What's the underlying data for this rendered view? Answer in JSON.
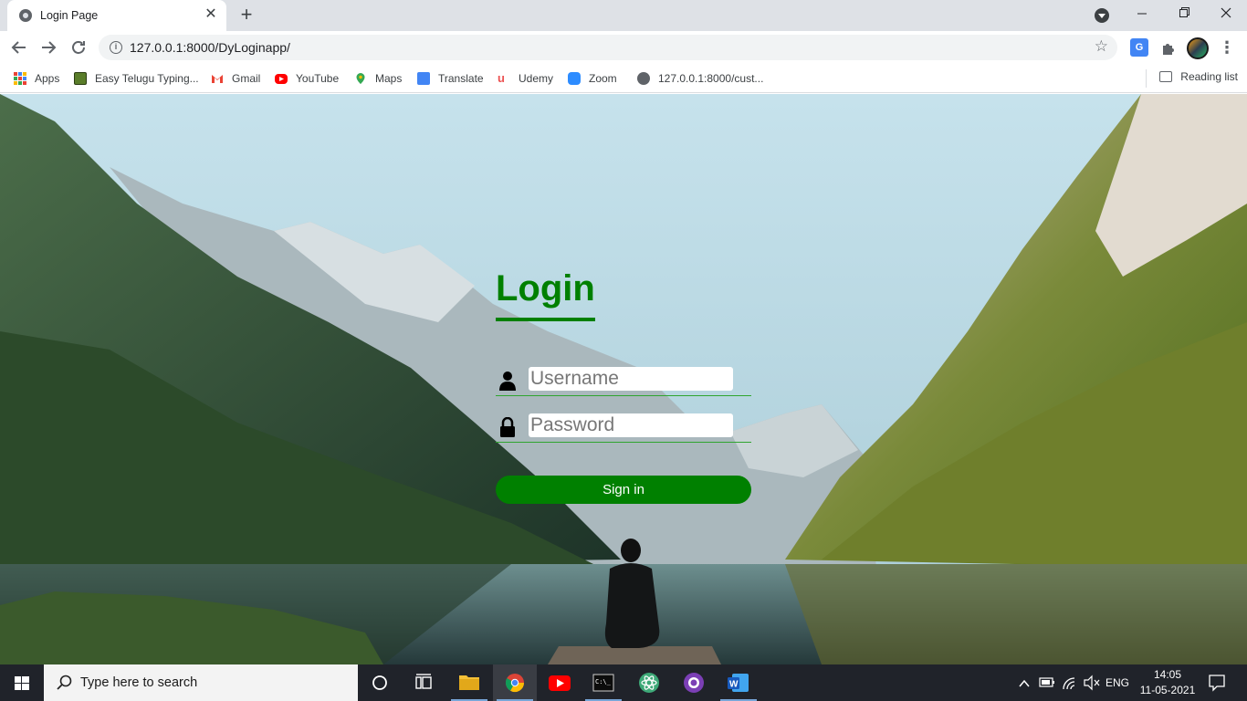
{
  "browser": {
    "tab_title": "Login Page",
    "url": "127.0.0.1:8000/DyLoginapp/",
    "bookmarks": [
      {
        "label": "Apps",
        "icon": "apps-grid-icon"
      },
      {
        "label": "Easy Telugu Typing...",
        "icon": "easy-telugu-icon"
      },
      {
        "label": "Gmail",
        "icon": "gmail-icon"
      },
      {
        "label": "YouTube",
        "icon": "youtube-icon"
      },
      {
        "label": "Maps",
        "icon": "maps-icon"
      },
      {
        "label": "Translate",
        "icon": "translate-icon"
      },
      {
        "label": "Udemy",
        "icon": "udemy-icon"
      },
      {
        "label": "Zoom",
        "icon": "zoom-icon"
      },
      {
        "label": "127.0.0.1:8000/cust...",
        "icon": "globe-icon"
      }
    ],
    "reading_list": "Reading list"
  },
  "login": {
    "title": "Login",
    "username_placeholder": "Username",
    "password_placeholder": "Password",
    "signin_label": "Sign in",
    "accent_color": "#008000"
  },
  "taskbar": {
    "search_placeholder": "Type here to search",
    "language": "ENG",
    "time": "14:05",
    "date": "11-05-2021",
    "pinned": [
      "task-view-icon",
      "file-explorer-icon",
      "chrome-icon",
      "youtube-icon",
      "terminal-icon",
      "atom-icon",
      "github-icon",
      "word-icon"
    ]
  }
}
